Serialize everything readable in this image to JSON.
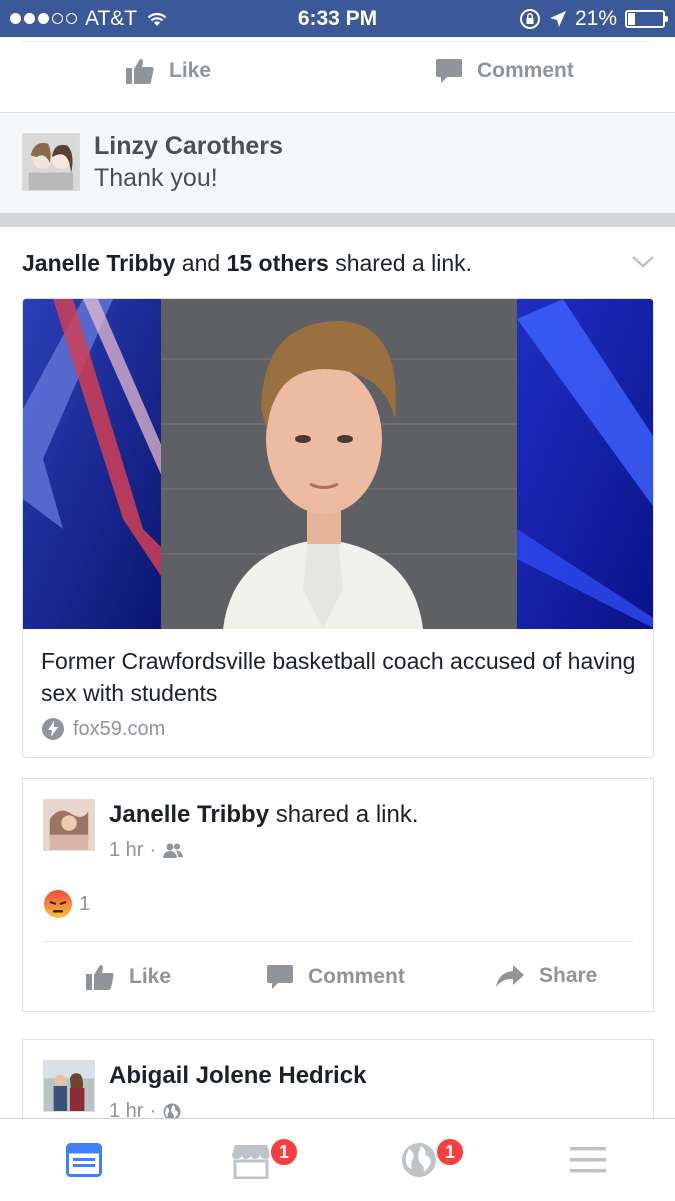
{
  "status_bar": {
    "carrier": "AT&T",
    "time": "6:33 PM",
    "battery": "21%",
    "battery_level": 0.21
  },
  "top_actions": {
    "like": "Like",
    "comment": "Comment"
  },
  "comment": {
    "name": "Linzy Carothers",
    "text": "Thank you!"
  },
  "story": {
    "header_name": "Janelle Tribby",
    "header_and": "and",
    "header_others": "15 others",
    "header_rest": "shared a link.",
    "link_title": "Former Crawfordsville basketball coach accused of having sex with students",
    "link_source": "fox59.com"
  },
  "shared_post": {
    "name": "Janelle Tribby",
    "action": "shared a link.",
    "time": "1 hr",
    "separator": "·",
    "reaction_count": "1",
    "like": "Like",
    "comment": "Comment",
    "share": "Share"
  },
  "next_post": {
    "name": "Abigail Jolene Hedrick",
    "time": "1 hr",
    "separator": "·"
  },
  "tab_bar": {
    "marketplace_badge": "1",
    "notifications_badge": "1"
  },
  "colors": {
    "brand": "#3b5998",
    "muted": "#90949c",
    "badge": "#fa3e3e",
    "active_tab": "#4080ff"
  }
}
